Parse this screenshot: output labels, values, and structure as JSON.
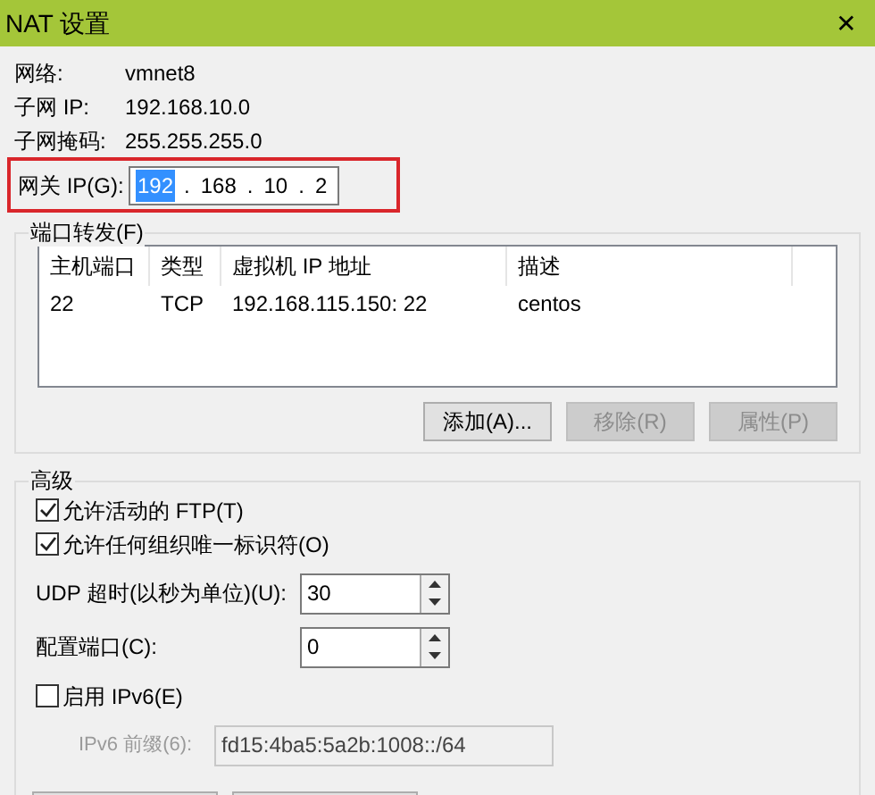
{
  "window": {
    "title": "NAT 设置",
    "close": "✕"
  },
  "info": [
    {
      "label": "网络:",
      "value": "vmnet8"
    },
    {
      "label": "子网 IP:",
      "value": "192.168.10.0"
    },
    {
      "label": "子网掩码:",
      "value": "255.255.255.0"
    }
  ],
  "gateway": {
    "label": "网关 IP(G):",
    "highlighted": true,
    "separator": ".",
    "octets": [
      {
        "text": "192",
        "selected": true
      },
      {
        "text": "168",
        "selected": false
      },
      {
        "text": "10",
        "selected": false
      },
      {
        "text": "2",
        "selected": false
      }
    ]
  },
  "port_forwarding": {
    "title": "端口转发(F)",
    "columns": [
      "主机端口",
      "类型",
      "虚拟机 IP 地址",
      "描述"
    ],
    "rows": [
      [
        "22",
        "TCP",
        "192.168.115.150: 22",
        "centos"
      ]
    ],
    "buttons": [
      {
        "label": "添加(A)...",
        "disabled": false
      },
      {
        "label": "移除(R)",
        "disabled": true
      },
      {
        "label": "属性(P)",
        "disabled": true
      }
    ]
  },
  "advanced": {
    "title": "高级",
    "options": [
      {
        "kind": "checkbox",
        "label": "允许活动的 FTP(T)",
        "checked": true
      },
      {
        "kind": "checkbox",
        "label": "允许任何组织唯一标识符(O)",
        "checked": true
      },
      {
        "kind": "spinner",
        "label": "UDP 超时(以秒为单位)(U):",
        "value": "30"
      },
      {
        "kind": "spinner",
        "label": "配置端口(C):",
        "value": "0"
      },
      {
        "kind": "checkbox",
        "label": "启用 IPv6(E)",
        "checked": false
      },
      {
        "kind": "field",
        "label": "IPv6 前缀(6):",
        "value": "fd15:4ba5:5a2b:1008::/64",
        "disabled": true
      }
    ]
  }
}
